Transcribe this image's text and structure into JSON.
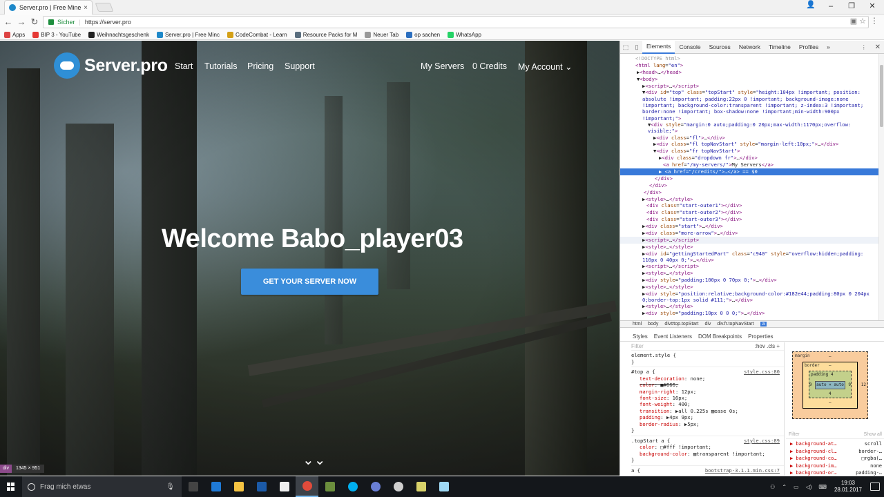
{
  "browser": {
    "tab_title": "Server.pro | Free Minecra",
    "close_glyph": "×",
    "secure_label": "Sicher",
    "url": "https://server.pro",
    "bookmarks": [
      {
        "label": "Apps",
        "color": "#d44"
      },
      {
        "label": "BIP 3 - YouTube",
        "color": "#e53935"
      },
      {
        "label": "Weihnachtsgeschenk",
        "color": "#222"
      },
      {
        "label": "Server.pro | Free Minc",
        "color": "#1e88c9"
      },
      {
        "label": "CodeCombat - Learn",
        "color": "#d4a017"
      },
      {
        "label": "Resource Packs for M",
        "color": "#5a6e7f"
      },
      {
        "label": "Neuer Tab",
        "color": "#999"
      },
      {
        "label": "op sachen",
        "color": "#2c6fbf"
      },
      {
        "label": "WhatsApp",
        "color": "#25d366"
      }
    ]
  },
  "site": {
    "logo_text": "Server.pro",
    "nav_left": [
      "Start",
      "Tutorials",
      "Pricing",
      "Support"
    ],
    "nav_right": [
      "My Servers",
      "0 Credits",
      "My Account ⌄"
    ],
    "welcome": "Welcome Babo_player03",
    "cta": "GET YOUR SERVER NOW",
    "scroll_arrow": "⌄⌄",
    "inspect_tag": "div",
    "inspect_size": "1345 × 951"
  },
  "devtools": {
    "tabs": [
      "Elements",
      "Console",
      "Sources",
      "Network",
      "Timeline",
      "Profiles",
      "»"
    ],
    "active_tab": "Elements",
    "breadcrumbs": [
      "html",
      "body",
      "div#top.topStart",
      "div",
      "div.fr.topNavStart",
      "a"
    ],
    "sub_tabs": [
      "Styles",
      "Event Listeners",
      "DOM Breakpoints",
      "Properties"
    ],
    "filter_placeholder": "Filter",
    "filter_right": ":hov  .cls  +",
    "element_style": "element.style {",
    "close_brace": "}",
    "rule1_selector": "#top a {",
    "rule1_source": "style.css:80",
    "rule1_props": [
      {
        "name": "text-decoration",
        "value": "none;",
        "strike": false
      },
      {
        "name": "color",
        "value": "■#666;",
        "strike": true
      },
      {
        "name": "margin-right",
        "value": "12px;",
        "strike": false
      },
      {
        "name": "font-size",
        "value": "16px;",
        "strike": false
      },
      {
        "name": "font-weight",
        "value": "400;",
        "strike": false
      },
      {
        "name": "transition",
        "value": "▶all 0.225s ▨ease 0s;",
        "strike": false
      },
      {
        "name": "padding",
        "value": "▶4px 9px;",
        "strike": false
      },
      {
        "name": "border-radius",
        "value": "▶5px;",
        "strike": false
      }
    ],
    "rule2_selector": ".topStart a {",
    "rule2_source": "style.css:89",
    "rule2_props": [
      {
        "name": "color",
        "value": "□#fff !important;"
      },
      {
        "name": "background-color",
        "value": "▨transparent !important;"
      }
    ],
    "rule3_selector": "a {",
    "rule3_source": "bootstrap-3.1.1.min.css:7",
    "boxmodel": {
      "margin": "margin",
      "border": "border",
      "padding": "padding 4",
      "content": "auto × auto",
      "left": "9",
      "right": "9",
      "right_margin": "12",
      "dash": "–",
      "bottom": "4"
    },
    "computed_filter": "Filter",
    "show_all": "Show all",
    "computed": [
      {
        "k": "▶ background-at…",
        "v": "scroll"
      },
      {
        "k": "▶ background-cl…",
        "v": "border-…"
      },
      {
        "k": "▶ background-co…",
        "v": "□rgba(…"
      },
      {
        "k": "▶ background-im…",
        "v": "none"
      },
      {
        "k": "▶ background-or…",
        "v": "padding-…"
      }
    ]
  },
  "taskbar": {
    "search_placeholder": "Frag mich etwas",
    "time": "19:03",
    "date": "28.01.2017",
    "apps": [
      {
        "name": "task-view",
        "color": "#444"
      },
      {
        "name": "edge",
        "color": "#1f7ad6"
      },
      {
        "name": "explorer",
        "color": "#f5c342"
      },
      {
        "name": "app-blue",
        "color": "#1b5aa8"
      },
      {
        "name": "store",
        "color": "#eee"
      },
      {
        "name": "chrome",
        "color": "#e14b3b"
      },
      {
        "name": "minecraft",
        "color": "#6b8e3d"
      },
      {
        "name": "skype",
        "color": "#00aff0"
      },
      {
        "name": "app-circle",
        "color": "#6a7fd6"
      },
      {
        "name": "app-wheel",
        "color": "#cfcfcf"
      },
      {
        "name": "app-film",
        "color": "#d8d26a"
      },
      {
        "name": "app-feather",
        "color": "#9fd9f5"
      }
    ]
  }
}
